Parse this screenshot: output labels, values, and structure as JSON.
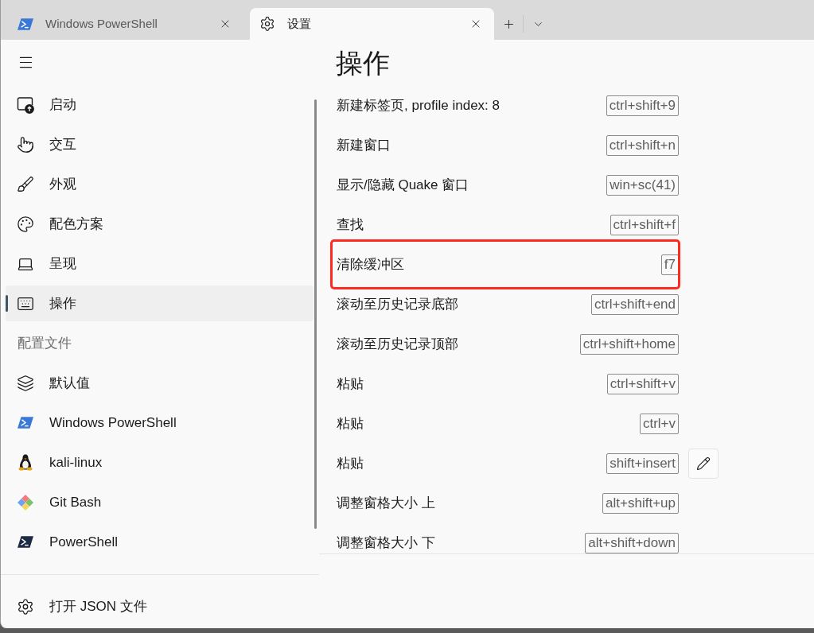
{
  "tabs": [
    {
      "title": "Windows PowerShell",
      "selected": false
    },
    {
      "title": "设置",
      "selected": true
    }
  ],
  "sidebar": {
    "nav_items": [
      {
        "label": "启动",
        "selected": false
      },
      {
        "label": "交互",
        "selected": false
      },
      {
        "label": "外观",
        "selected": false
      },
      {
        "label": "配色方案",
        "selected": false
      },
      {
        "label": "呈现",
        "selected": false
      },
      {
        "label": "操作",
        "selected": true
      }
    ],
    "section_header": "配置文件",
    "profiles": [
      {
        "label": "默认值",
        "selected": false
      },
      {
        "label": "Windows PowerShell",
        "selected": false
      },
      {
        "label": "kali-linux",
        "selected": false
      },
      {
        "label": "Git Bash",
        "selected": false
      },
      {
        "label": "PowerShell",
        "selected": false
      }
    ],
    "footer_item": "打开 JSON 文件"
  },
  "page": {
    "title": "操作",
    "actions": [
      {
        "name": "新建标签页, profile index: 8",
        "keys": "ctrl+shift+9",
        "highlighted": false,
        "hovered": false
      },
      {
        "name": "新建窗口",
        "keys": "ctrl+shift+n",
        "highlighted": false,
        "hovered": false
      },
      {
        "name": "显示/隐藏 Quake 窗口",
        "keys": "win+sc(41)",
        "highlighted": false,
        "hovered": false
      },
      {
        "name": "查找",
        "keys": "ctrl+shift+f",
        "highlighted": false,
        "hovered": false
      },
      {
        "name": "清除缓冲区",
        "keys": "f7",
        "highlighted": true,
        "hovered": false
      },
      {
        "name": "滚动至历史记录底部",
        "keys": "ctrl+shift+end",
        "highlighted": false,
        "hovered": false
      },
      {
        "name": "滚动至历史记录顶部",
        "keys": "ctrl+shift+home",
        "highlighted": false,
        "hovered": false
      },
      {
        "name": "粘贴",
        "keys": "ctrl+shift+v",
        "highlighted": false,
        "hovered": false
      },
      {
        "name": "粘贴",
        "keys": "ctrl+v",
        "highlighted": false,
        "hovered": false
      },
      {
        "name": "粘贴",
        "keys": "shift+insert",
        "highlighted": false,
        "hovered": true
      },
      {
        "name": "调整窗格大小 上",
        "keys": "alt+shift+up",
        "highlighted": false,
        "hovered": false
      },
      {
        "name": "调整窗格大小 下",
        "keys": "alt+shift+down",
        "highlighted": false,
        "hovered": false
      }
    ]
  }
}
